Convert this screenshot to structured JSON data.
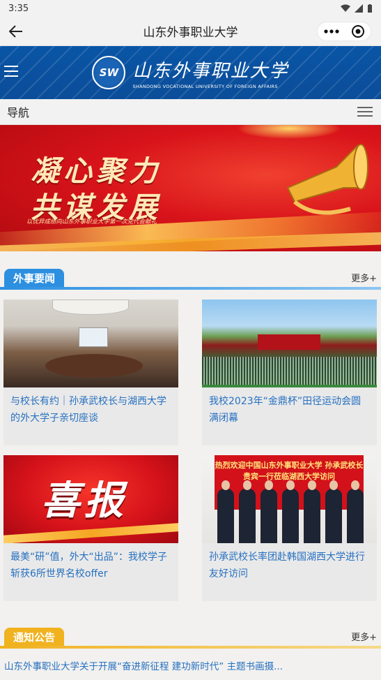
{
  "status_bar": {
    "time": "3:35"
  },
  "title_bar": {
    "title": "山东外事职业大学"
  },
  "site_header": {
    "logo_mark": "SW",
    "name_cn": "山东外事职业大学",
    "name_en": "SHANDONG VOCATIONAL UNIVERSITY OF FOREIGN AFFAIRS"
  },
  "nav_bar": {
    "label": "导航"
  },
  "hero": {
    "line1": "凝心聚力",
    "line2": "共谋发展",
    "subtitle": "以优异成绩向山东外事职业大学第一次党代会献礼"
  },
  "news_section": {
    "tab_label": "外事要闻",
    "more_label": "更多+",
    "items": [
      {
        "caption": "与校长有约｜孙承武校长与湖西大学的外大学子亲切座谈"
      },
      {
        "caption": "我校2023年“金鼎杯”田径运动会圆满闭幕"
      },
      {
        "caption": "最美“研”值，外大“出品”：我校学子斩获6所世界名校offer",
        "image_text": "喜报"
      },
      {
        "caption": "孙承武校长率团赴韩国湖西大学进行友好访问",
        "image_text": "热烈欢迎中国山东外事职业大学 孙承武校长贵宾一行莅临湖西大学访问"
      }
    ]
  },
  "notice_section": {
    "tab_label": "通知公告",
    "more_label": "更多+",
    "items": [
      {
        "title": "山东外事职业大学关于开展“奋进新征程 建功新时代” 主题书画摄..."
      }
    ]
  },
  "colors": {
    "header_blue": "#0b4d99",
    "tab_blue": "#2d8fe0",
    "tab_gold": "#f0b21f",
    "link_blue": "#2670c0",
    "hero_red": "#d8131a"
  }
}
